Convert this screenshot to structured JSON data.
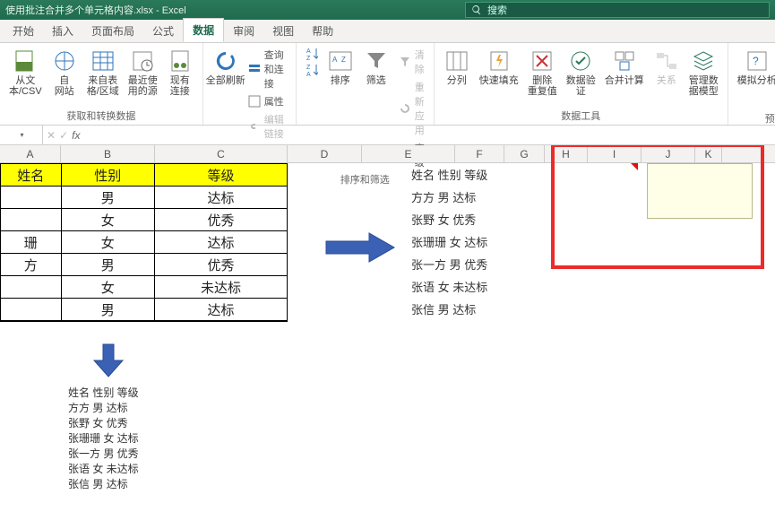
{
  "app": {
    "doc_title": "使用批注合并多个单元格内容.xlsx - Excel"
  },
  "search": {
    "placeholder": "搜索"
  },
  "tabs": {
    "start": "开始",
    "insert": "插入",
    "layout": "页面布局",
    "formula": "公式",
    "data": "数据",
    "review": "审阅",
    "view": "视图",
    "help": "帮助"
  },
  "ribbon": {
    "g1": {
      "csv": "从文\n本/CSV",
      "web": "自\n网站",
      "table": "来自表\n格/区域",
      "recent": "最近使\n用的源",
      "exist": "现有\n连接",
      "label": "获取和转换数据"
    },
    "g2": {
      "refresh": "全部刷新",
      "qc": "查询和连接",
      "prop": "属性",
      "edit": "编辑链接",
      "label": "查询和连接"
    },
    "g3": {
      "az": "A↓Z",
      "za": "Z↓A",
      "sort": "排序",
      "filter": "筛选",
      "clear": "清除",
      "reapply": "重新应用",
      "adv": "高级",
      "label": "排序和筛选"
    },
    "g4": {
      "split": "分列",
      "flash": "快速填充",
      "dup": "删除\n重复值",
      "valid": "数据验\n证",
      "consol": "合并计算",
      "rel": "关系",
      "mgmt": "管理数\n据模型",
      "label": "数据工具"
    },
    "g5": {
      "whatif": "模拟分析",
      "fore": "预\n测\n工",
      "label": "预测"
    }
  },
  "fbar": {
    "fx": "fx"
  },
  "columns": [
    "A",
    "B",
    "C",
    "D",
    "E",
    "F",
    "G",
    "H",
    "I",
    "J",
    "K"
  ],
  "table": {
    "headers": [
      "姓名",
      "性别",
      "等级"
    ],
    "rows": [
      [
        "",
        "男",
        "达标"
      ],
      [
        "",
        "女",
        "优秀"
      ],
      [
        "珊",
        "女",
        "达标"
      ],
      [
        "方",
        "男",
        "优秀"
      ],
      [
        "",
        "女",
        "未达标"
      ],
      [
        "",
        "男",
        "达标"
      ]
    ]
  },
  "listE": [
    "姓名 性别 等级",
    "方方 男 达标",
    "张野 女 优秀",
    "张珊珊 女 达标",
    "张一方 男 优秀",
    "张语 女 未达标",
    "张信 男 达标"
  ],
  "listBottom": [
    "姓名 性别 等级",
    "方方 男 达标",
    "张野 女 优秀",
    "张珊珊 女 达标",
    "张一方 男 优秀",
    "张语 女 未达标",
    "张信 男 达标"
  ]
}
